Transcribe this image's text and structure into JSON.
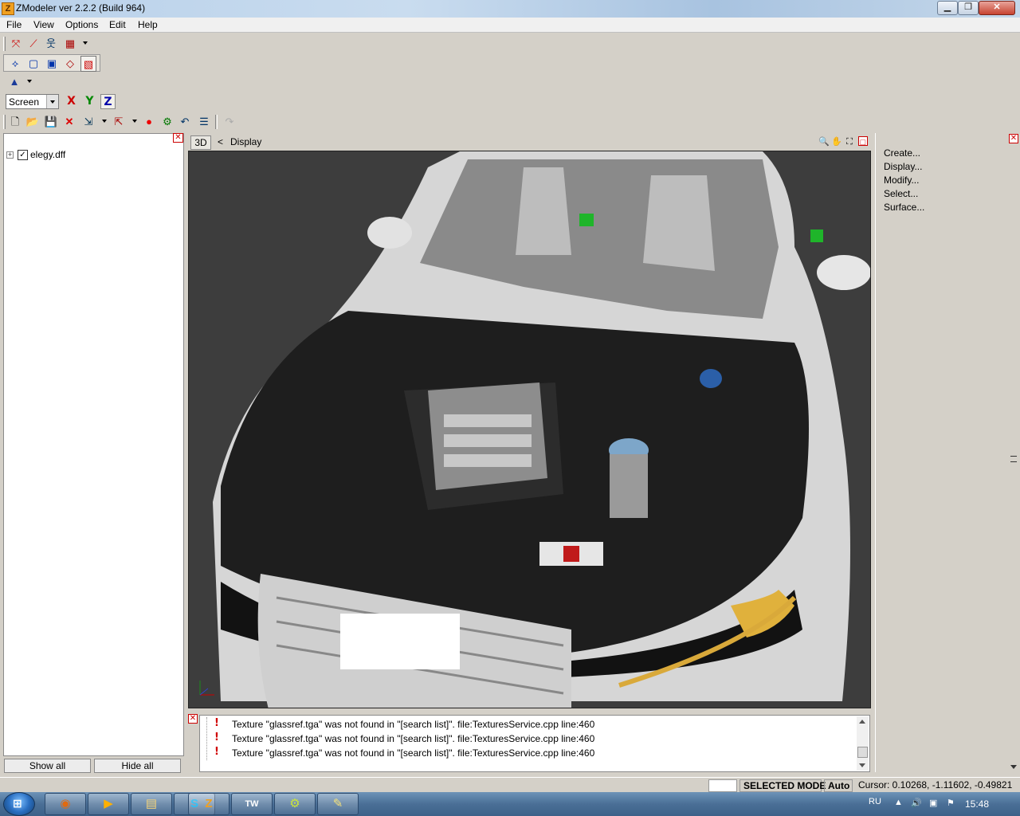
{
  "window": {
    "title": "ZModeler ver 2.2.2 (Build 964)"
  },
  "menu": [
    "File",
    "View",
    "Options",
    "Edit",
    "Help"
  ],
  "toolbar_axes": {
    "coord_system": "Screen",
    "x": "X",
    "y": "Y",
    "z": "Z"
  },
  "scene_tree": {
    "item": "elegy.dff",
    "checked": true,
    "show_all": "Show all",
    "hide_all": "Hide all"
  },
  "viewport": {
    "tab": "3D",
    "chevron": "<",
    "mode_label": "Display"
  },
  "console": {
    "lines": [
      "Texture \"glassref.tga\" was not found in \"[search list]\". file:TexturesService.cpp line:460",
      "Texture \"glassref.tga\" was not found in \"[search list]\". file:TexturesService.cpp line:460",
      "Texture \"glassref.tga\" was not found in \"[search list]\". file:TexturesService.cpp line:460"
    ]
  },
  "commands": [
    "Create...",
    "Display...",
    "Modify...",
    "Select...",
    "Surface..."
  ],
  "status": {
    "mode": "SELECTED MODE",
    "auto": "Auto",
    "cursor": "Cursor: 0.10268, -1.11602, -0.49821"
  },
  "taskbar": {
    "lang": "RU",
    "clock": "15:48"
  },
  "colors": {
    "viewport_bg": "#3d3d3d",
    "accent_red": "#d00000",
    "window_bg": "#d4d0c8"
  },
  "icons": [
    "app-icon",
    "new-file-icon",
    "open-file-icon",
    "save-icon",
    "delete-icon",
    "undo-icon",
    "zoom-icon",
    "pan-hand-icon",
    "maximize-viewport-icon",
    "close-icon",
    "warning-icon"
  ]
}
